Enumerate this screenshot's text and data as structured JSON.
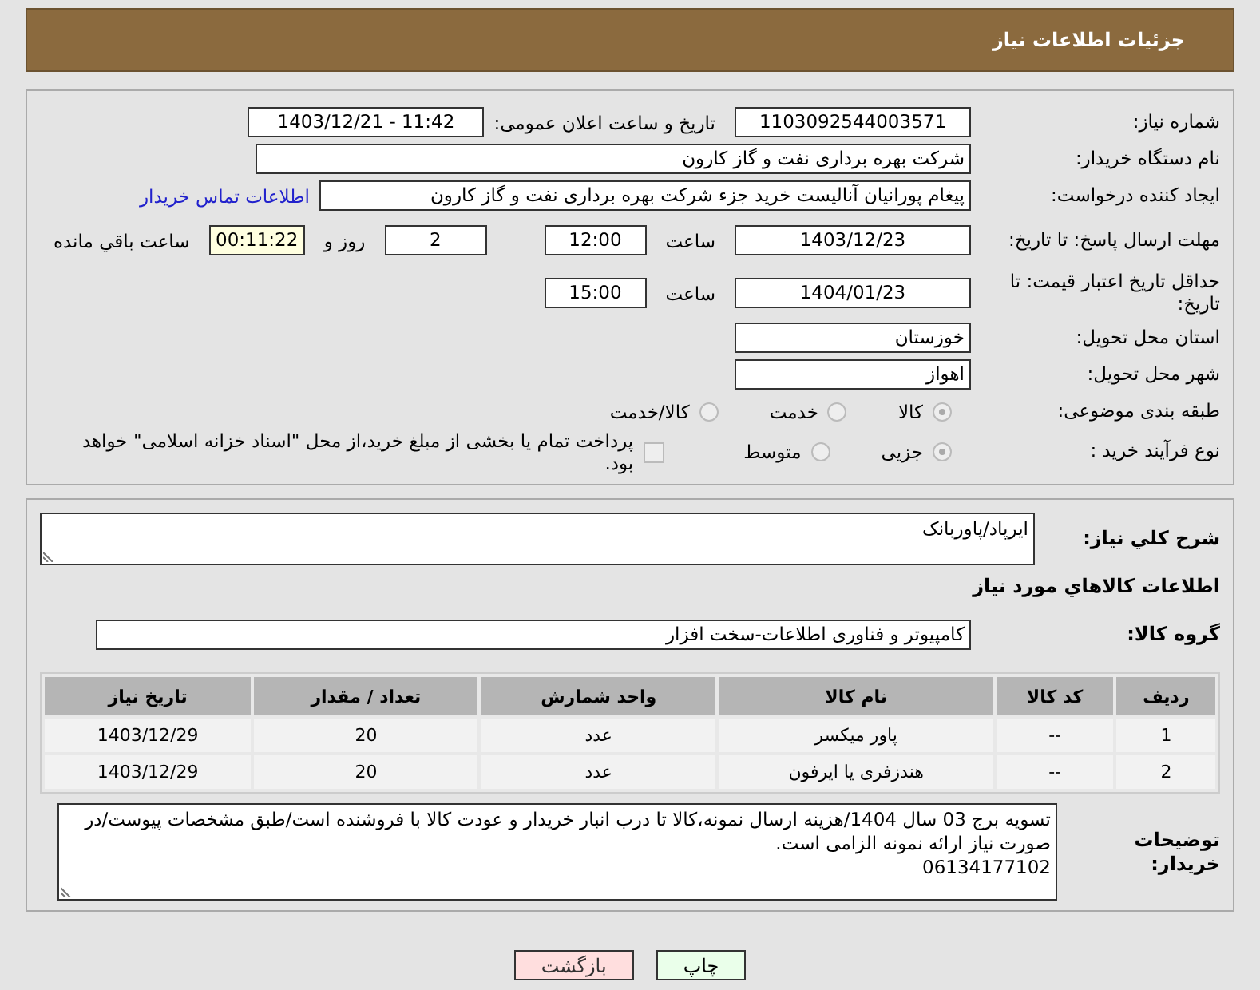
{
  "header": {
    "title": "جزئیات اطلاعات نیاز"
  },
  "need_number": {
    "label": "شماره نیاز:",
    "value": "1103092544003571"
  },
  "announce": {
    "label": "تاریخ و ساعت اعلان عمومی:",
    "value": "1403/12/21 - 11:42"
  },
  "buyer_org": {
    "label": "نام دستگاه خریدار:",
    "value": "شرکت بهره برداری نفت و گاز کارون"
  },
  "requester": {
    "label": "ایجاد کننده درخواست:",
    "value": "پیغام پورانیان آنالیست خرید جزء شرکت بهره برداری نفت و گاز کارون",
    "link": "اطلاعات تماس خریدار"
  },
  "deadline": {
    "label": "مهلت ارسال پاسخ: تا تاریخ:",
    "date": "1403/12/23",
    "time_label": "ساعت",
    "time": "12:00",
    "days": "2",
    "days_label": "روز و",
    "remaining": "00:11:22",
    "remaining_label": "ساعت باقي مانده"
  },
  "validity": {
    "label": "حداقل تاریخ اعتبار قیمت: تا تاریخ:",
    "date": "1404/01/23",
    "time_label": "ساعت",
    "time": "15:00"
  },
  "province": {
    "label": "استان محل تحویل:",
    "value": "خوزستان"
  },
  "city": {
    "label": "شهر محل تحویل:",
    "value": "اهواز"
  },
  "category": {
    "label": "طبقه بندی موضوعی:",
    "options": [
      {
        "label": "کالا",
        "selected": true
      },
      {
        "label": "خدمت",
        "selected": false
      },
      {
        "label": "کالا/خدمت",
        "selected": false
      }
    ]
  },
  "process": {
    "label": "نوع فرآیند خرید :",
    "options": [
      {
        "label": "جزیی",
        "selected": true
      },
      {
        "label": "متوسط",
        "selected": false
      }
    ],
    "treasury": {
      "label": "پرداخت تمام یا بخشی از مبلغ خرید،از محل \"اسناد خزانه اسلامی\" خواهد بود.",
      "checked": false
    }
  },
  "summary": {
    "label": "شرح کلي نیاز:",
    "value": "ایرپاد/پاوربانک"
  },
  "goods_heading": "اطلاعات کالاهاي مورد نیاز",
  "goods_group": {
    "label": "گروه کالا:",
    "value": "کامپیوتر و فناوری اطلاعات-سخت افزار"
  },
  "table": {
    "columns": [
      "ردیف",
      "کد کالا",
      "نام کالا",
      "واحد شمارش",
      "تعداد / مقدار",
      "تاریخ نیاز"
    ],
    "rows": [
      [
        "1",
        "--",
        "پاور میکسر",
        "عدد",
        "20",
        "1403/12/29"
      ],
      [
        "2",
        "--",
        "هندزفری یا ایرفون",
        "عدد",
        "20",
        "1403/12/29"
      ]
    ]
  },
  "buyer_notes": {
    "label": "توضیحات خریدار:",
    "lines": [
      "تسویه برج 03 سال 1404/هزینه ارسال نمونه،کالا تا درب انبار خریدار و عودت کالا با فروشنده است/طبق مشخصات پیوست/در صورت نیاز ارائه نمونه الزامی است.",
      "06134177102"
    ]
  },
  "buttons": [
    {
      "label": "چاپ",
      "kind": "print"
    },
    {
      "label": "بازگشت",
      "kind": "back"
    }
  ]
}
